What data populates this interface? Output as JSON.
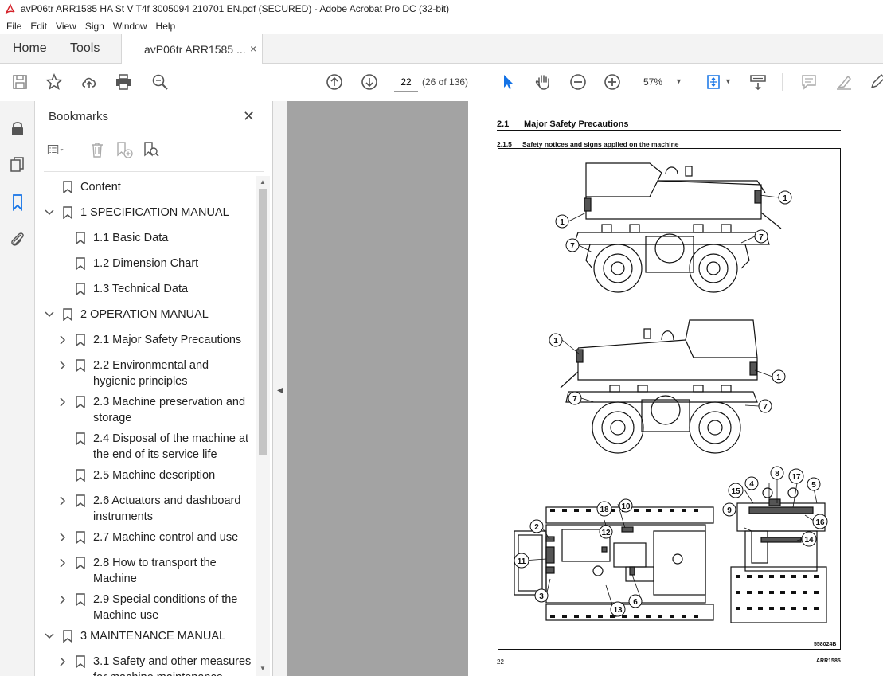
{
  "window": {
    "title": "avP06tr ARR1585 HA St V T4f 3005094 210701 EN.pdf (SECURED) - Adobe Acrobat Pro DC (32-bit)"
  },
  "menu": [
    "File",
    "Edit",
    "View",
    "Sign",
    "Window",
    "Help"
  ],
  "tabs": {
    "home": "Home",
    "tools": "Tools",
    "document": "avP06tr ARR1585 ...",
    "close": "×"
  },
  "toolbar": {
    "page_current": "22",
    "page_count": "(26 of 136)",
    "zoom": "57%"
  },
  "bookmarks": {
    "title": "Bookmarks",
    "close": "✕",
    "items": [
      {
        "label": "Content",
        "level": 0,
        "expander": "none"
      },
      {
        "label": "1 SPECIFICATION MANUAL",
        "level": 0,
        "expander": "expanded"
      },
      {
        "label": "1.1 Basic Data",
        "level": 1,
        "expander": "none"
      },
      {
        "label": "1.2 Dimension Chart",
        "level": 1,
        "expander": "none"
      },
      {
        "label": "1.3 Technical Data",
        "level": 1,
        "expander": "none"
      },
      {
        "label": "2 OPERATION MANUAL",
        "level": 0,
        "expander": "expanded"
      },
      {
        "label": "2.1 Major Safety Precautions",
        "level": 1,
        "expander": "collapsed"
      },
      {
        "label": "2.2 Environmental and",
        "label2": "hygienic principles",
        "level": 1,
        "expander": "collapsed"
      },
      {
        "label": "2.3 Machine preservation and",
        "label2": "storage",
        "level": 1,
        "expander": "collapsed"
      },
      {
        "label": "2.4 Disposal of the machine at",
        "label2": "the end of its service life",
        "level": 1,
        "expander": "none"
      },
      {
        "label": "2.5 Machine description",
        "level": 1,
        "expander": "none"
      },
      {
        "label": "2.6 Actuators and dashboard",
        "label2": "instruments",
        "level": 1,
        "expander": "collapsed"
      },
      {
        "label": "2.7 Machine control and use",
        "level": 1,
        "expander": "collapsed"
      },
      {
        "label": "2.8 How to transport the",
        "label2": "Machine",
        "level": 1,
        "expander": "collapsed"
      },
      {
        "label": "2.9 Special conditions of the",
        "label2": "Machine use",
        "level": 1,
        "expander": "collapsed"
      },
      {
        "label": "3 MAINTENANCE MANUAL",
        "level": 0,
        "expander": "expanded"
      },
      {
        "label": "3.1 Safety and other measures",
        "label2": "for machine maintenance",
        "level": 1,
        "expander": "collapsed"
      }
    ]
  },
  "page": {
    "section_num": "2.1",
    "section_title": "Major Safety Precautions",
    "subsection_num": "2.1.5",
    "subsection_title": "Safety notices and signs applied on the machine",
    "figure_code": "558024B",
    "page_number": "22",
    "doc_code": "ARR1585",
    "callouts": [
      "1",
      "1",
      "7",
      "7",
      "1",
      "1",
      "7",
      "7",
      "2",
      "3",
      "6",
      "10",
      "11",
      "12",
      "13",
      "18",
      "4",
      "5",
      "8",
      "9",
      "14",
      "15",
      "16",
      "17"
    ]
  }
}
